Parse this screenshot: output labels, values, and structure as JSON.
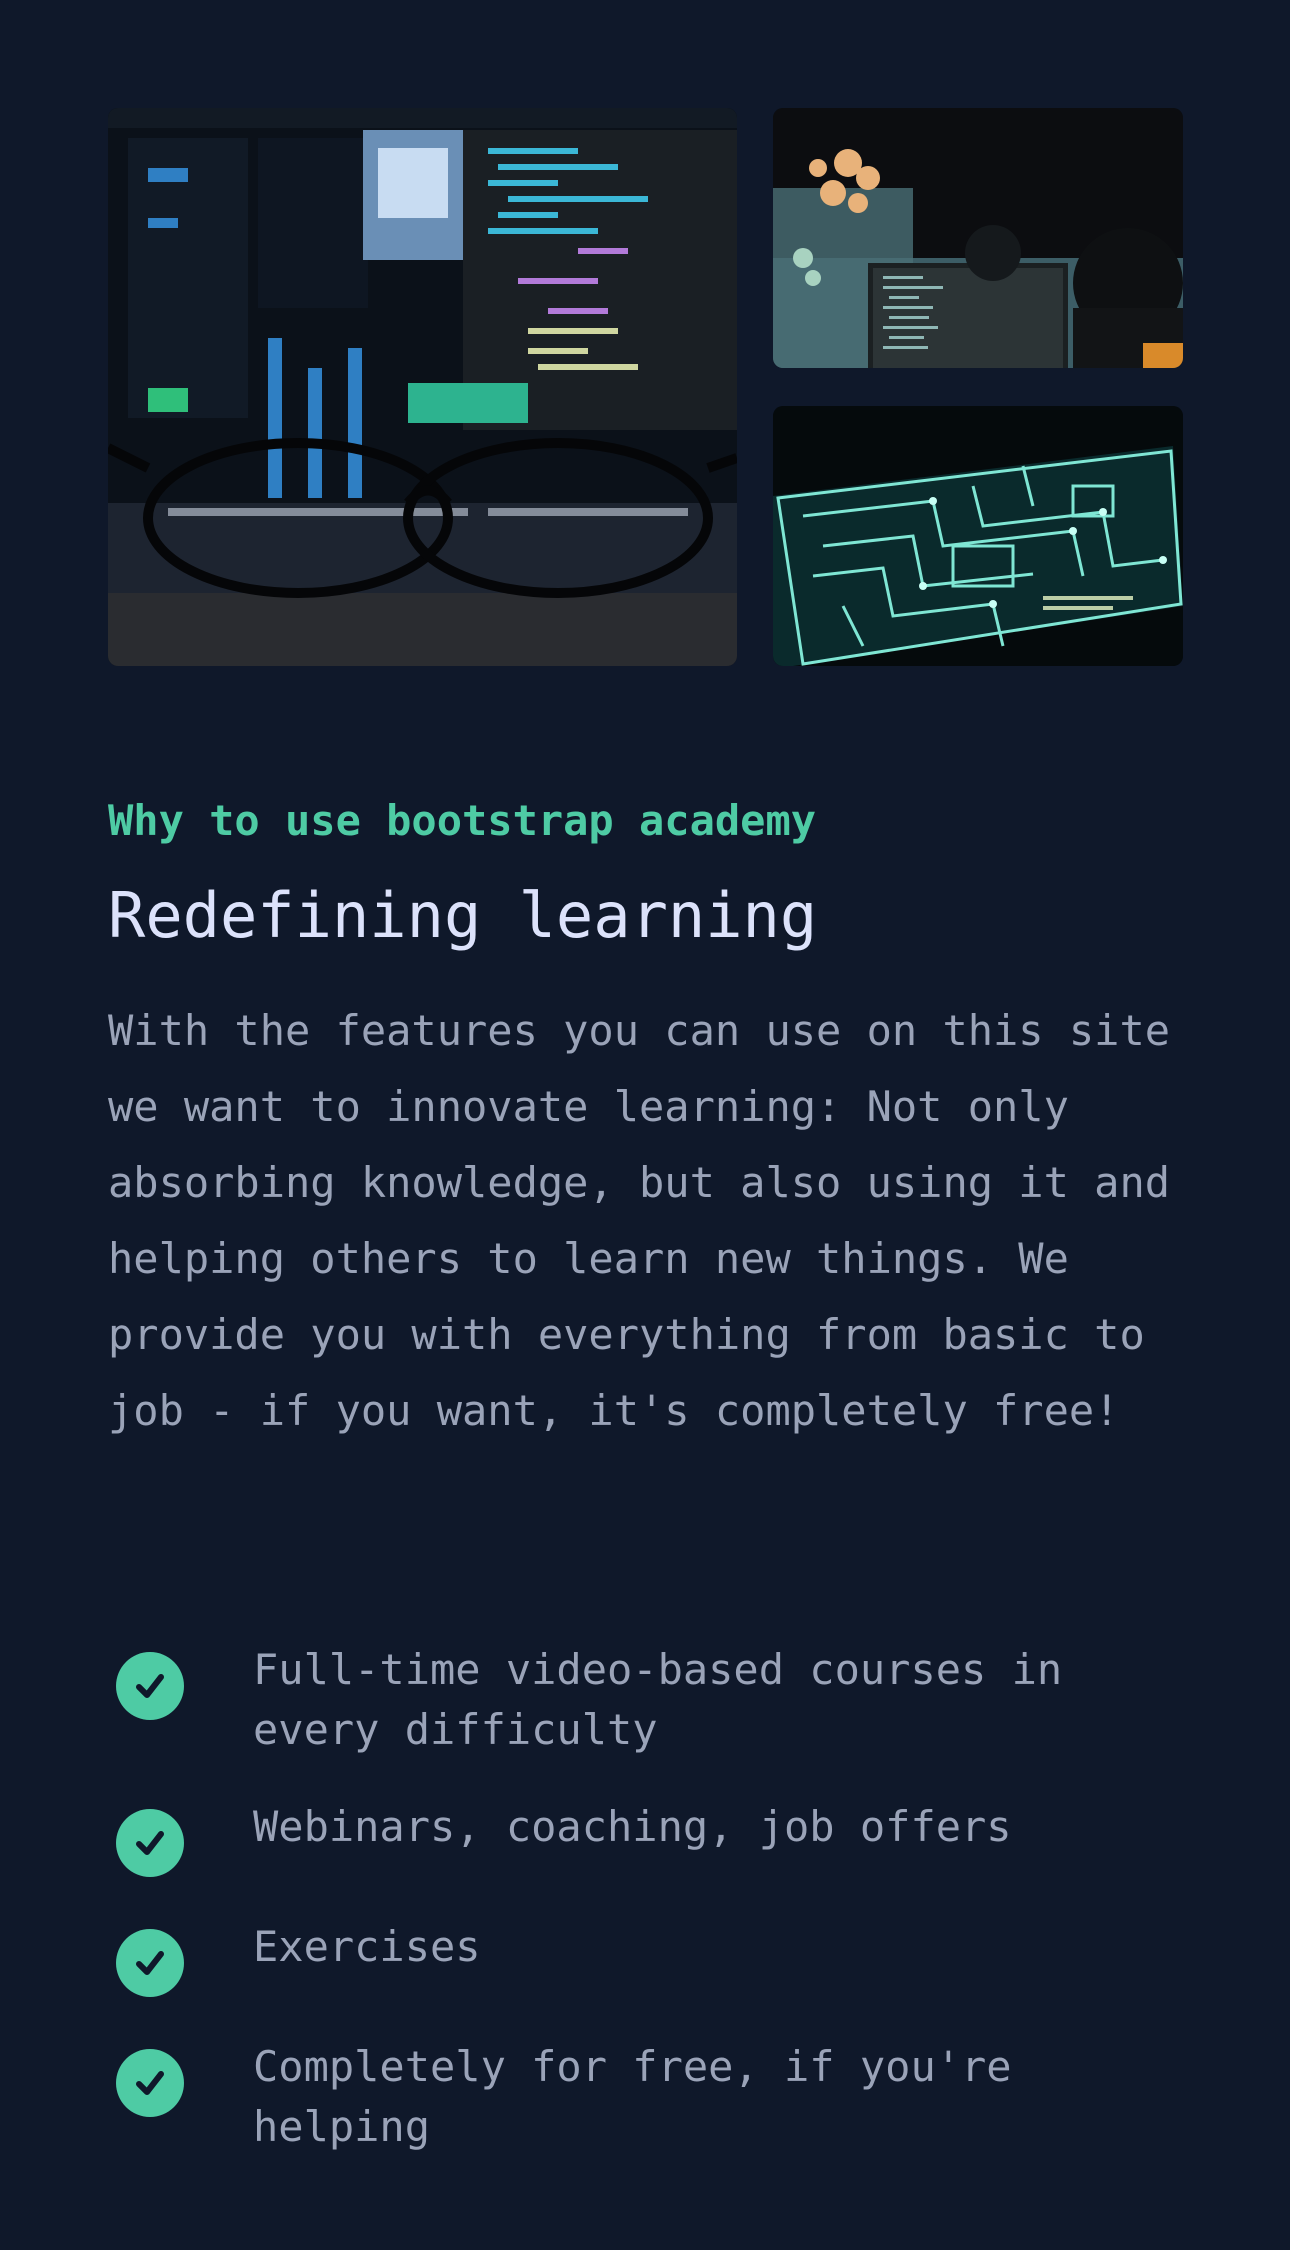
{
  "images": {
    "main": "code-on-monitor-behind-glasses",
    "top": "developer-at-screen-with-code",
    "board": "glowing-circuit-board"
  },
  "section": {
    "eyebrow": "Why to use bootstrap academy",
    "title": "Redefining learning",
    "lead": "With the features you can use on this site we want to innovate learning: Not only absorbing knowledge, but also using it and helping others to learn new things. We provide you with everything from basic to job - if you want, it's completely free!"
  },
  "features": [
    {
      "label": "Full-time video-based courses in every difficulty",
      "icon": "check-circle-icon"
    },
    {
      "label": "Webinars, coaching, job offers",
      "icon": "check-circle-icon"
    },
    {
      "label": "Exercises",
      "icon": "check-circle-icon"
    },
    {
      "label": "Completely for free, if you're helping",
      "icon": "check-circle-icon"
    }
  ],
  "colors": {
    "background": "#0f182a",
    "accent": "#4ecba4",
    "heading": "#dce2fb",
    "body_text": "#9aa3b8"
  }
}
